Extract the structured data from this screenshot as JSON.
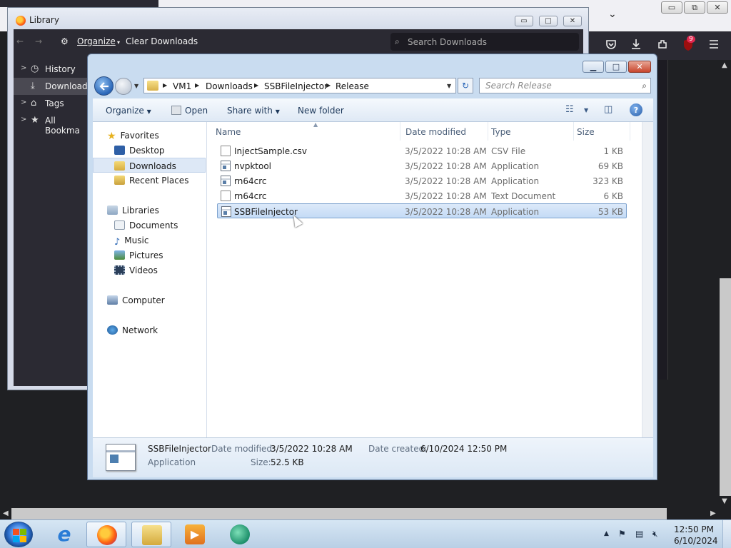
{
  "firefox": {
    "window_controls": {
      "minimize": "▭",
      "restore": "⧉",
      "close": "✕"
    },
    "menu_chevron": "⌄",
    "toolbar_icons": [
      "pocket-icon",
      "download-icon",
      "extensions-icon",
      "ublock-icon",
      "menu-icon"
    ],
    "badge_count": "9"
  },
  "library": {
    "title": "Library",
    "toolbar": {
      "organize": "Organize",
      "clear_downloads": "Clear Downloads",
      "search_placeholder": "Search Downloads"
    },
    "sidebar": [
      {
        "label": "History",
        "icon": "clock-icon",
        "selected": false
      },
      {
        "label": "Downloads",
        "icon": "download-icon",
        "selected": true
      },
      {
        "label": "Tags",
        "icon": "tag-icon",
        "selected": false
      },
      {
        "label": "All Bookma",
        "icon": "star-icon",
        "selected": false
      }
    ]
  },
  "explorer": {
    "breadcrumb": [
      "VM1",
      "Downloads",
      "SSBFileInjector",
      "Release"
    ],
    "search_placeholder": "Search Release",
    "commands": {
      "organize": "Organize",
      "open": "Open",
      "share_with": "Share with",
      "new_folder": "New folder"
    },
    "nav": {
      "favorites": "Favorites",
      "desktop": "Desktop",
      "downloads": "Downloads",
      "recent_places": "Recent Places",
      "libraries": "Libraries",
      "documents": "Documents",
      "music": "Music",
      "pictures": "Pictures",
      "videos": "Videos",
      "computer": "Computer",
      "network": "Network"
    },
    "columns": {
      "name": "Name",
      "date": "Date modified",
      "type": "Type",
      "size": "Size"
    },
    "files": [
      {
        "name": "InjectSample.csv",
        "date": "3/5/2022 10:28 AM",
        "type": "CSV File",
        "size": "1 KB",
        "icon": "csv-file-icon"
      },
      {
        "name": "nvpktool",
        "date": "3/5/2022 10:28 AM",
        "type": "Application",
        "size": "69 KB",
        "icon": "application-icon"
      },
      {
        "name": "rn64crc",
        "date": "3/5/2022 10:28 AM",
        "type": "Application",
        "size": "323 KB",
        "icon": "application-icon"
      },
      {
        "name": "rn64crc",
        "date": "3/5/2022 10:28 AM",
        "type": "Text Document",
        "size": "6 KB",
        "icon": "text-file-icon"
      },
      {
        "name": "SSBFileInjector",
        "date": "3/5/2022 10:28 AM",
        "type": "Application",
        "size": "53 KB",
        "icon": "application-icon",
        "selected": true
      }
    ],
    "details": {
      "name": "SSBFileInjector",
      "type": "Application",
      "date_modified_label": "Date modified:",
      "date_modified": "3/5/2022 10:28 AM",
      "size_label": "Size:",
      "size": "52.5 KB",
      "date_created_label": "Date created:",
      "date_created": "6/10/2024 12:50 PM"
    }
  },
  "taskbar": {
    "apps": [
      "internet-explorer-icon",
      "firefox-icon",
      "file-explorer-icon",
      "media-player-icon",
      "chat-app-icon"
    ],
    "clock_time": "12:50 PM",
    "clock_date": "6/10/2024"
  }
}
